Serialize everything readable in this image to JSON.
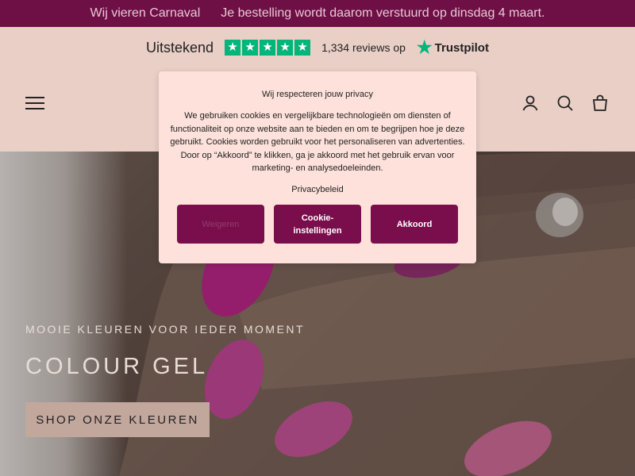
{
  "announcement": {
    "left": "Wij vieren Carnaval",
    "right": "Je bestelling wordt daarom verstuurd op dinsdag 4 maart."
  },
  "trustbar": {
    "rating_label": "Uitstekend",
    "stars": 5,
    "reviews": "1,334 reviews op",
    "brand": "Trustpilot"
  },
  "header": {
    "icons": [
      "menu-icon",
      "account-icon",
      "search-icon",
      "cart-icon"
    ]
  },
  "hero": {
    "eyebrow": "MOOIE KLEUREN VOOR IEDER MOMENT",
    "title": "COLOUR GEL",
    "cta": "SHOP ONZE KLEUREN"
  },
  "cookie_modal": {
    "title": "Wij respecteren jouw privacy",
    "body": "We gebruiken cookies en vergelijkbare technologieën om diensten of functionaliteit op onze website aan te bieden en om te begrijpen hoe je deze gebruikt. Cookies worden gebruikt voor het personaliseren van advertenties. Door op “Akkoord” te klikken, ga je akkoord met het gebruik ervan voor marketing- en analysedoeleinden.",
    "link": "Privacybeleid",
    "buttons": {
      "decline": "Weigeren",
      "settings": "Cookie-instellingen",
      "accept": "Akkoord"
    }
  },
  "colors": {
    "announcement_bg": "#6e0f45",
    "header_bg": "#e9cfc6",
    "modal_bg": "#fde1da",
    "button_bg": "#7a0e4c",
    "trustpilot_green": "#00b67a",
    "cta_bg": "#c2a79d"
  }
}
